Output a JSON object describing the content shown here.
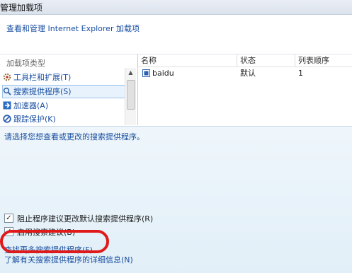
{
  "window": {
    "title": "管理加载项"
  },
  "header": {
    "description_link": "查看和管理 Internet Explorer 加载项"
  },
  "left_pane": {
    "group_label": "加载项类型",
    "categories": [
      {
        "label": "工具栏和扩展(T)",
        "icon": "gear-icon"
      },
      {
        "label": "搜索提供程序(S)",
        "icon": "search-icon",
        "selected": true
      },
      {
        "label": "加速器(A)",
        "icon": "accelerator-icon"
      },
      {
        "label": "跟踪保护(K)",
        "icon": "tracking-protection-icon"
      }
    ]
  },
  "list": {
    "columns": [
      "名称",
      "状态",
      "列表顺序"
    ],
    "rows": [
      {
        "name": "baidu",
        "status": "默认",
        "order": "1",
        "icon": "search-provider-icon"
      }
    ]
  },
  "details": {
    "prompt": "请选择您想查看或更改的搜索提供程序。",
    "checkbox1": {
      "label": "阻止程序建议更改默认搜索提供程序(R)",
      "checked": true
    },
    "checkbox2": {
      "label": "启用搜索建议(B)",
      "checked": true
    },
    "find_more_link": "查找更多搜索提供程序(F)...",
    "learn_more_link": "了解有关搜索提供程序的详细信息(N)"
  },
  "colors": {
    "link": "#1a4fa0",
    "annotation": "#e01a1a",
    "panel_bg": "#e8f2fa"
  }
}
